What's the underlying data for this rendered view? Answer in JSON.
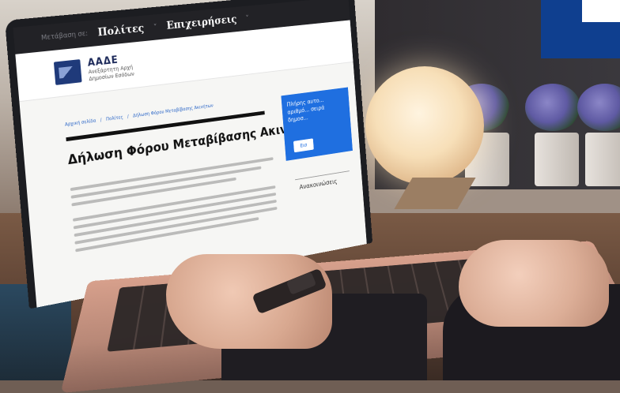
{
  "site": {
    "nav_faint": "Μετάβαση σε:",
    "nav_citizens": "Πολίτες",
    "nav_businesses": "Επιχειρήσεις",
    "brand_title": "ΑΑΔΕ",
    "brand_sub_line1": "Ανεξάρτητη Αρχή",
    "brand_sub_line2": "Δημοσίων Εσόδων",
    "breadcrumb": [
      "Αρχική σελίδα",
      "Πολίτες",
      "Δήλωση Φόρου Μεταβίβασης Ακινήτων"
    ],
    "page_title": "Δήλωση Φόρου Μεταβίβασης Ακινήτων",
    "side_card_text": "Πλήρης αυτο... αριθμό... σειρά δημοσ...",
    "side_card_button": "Εισ",
    "side_section": "Ανακοινώσεις"
  },
  "colors": {
    "accent_blue": "#1f6fe0",
    "corner_blue": "#0f3f8f",
    "topbar": "#222226"
  }
}
